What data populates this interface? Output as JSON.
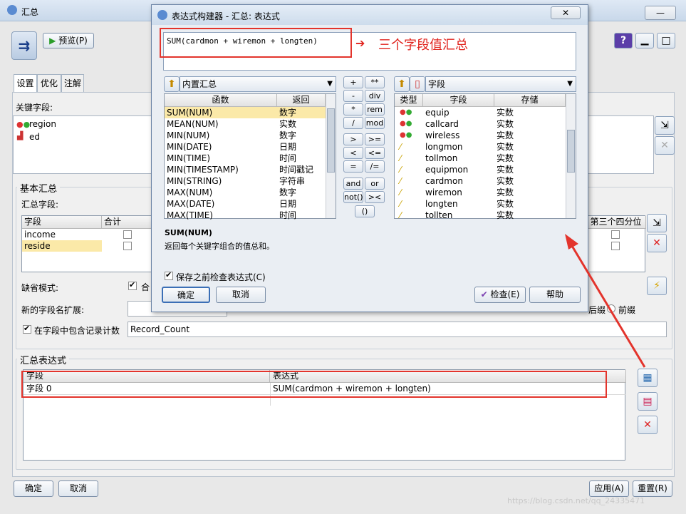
{
  "window": {
    "title": "汇总"
  },
  "toolbar": {
    "preview_label": "预览(P)"
  },
  "tabs": [
    "设置",
    "优化",
    "注解"
  ],
  "key_fields": {
    "label": "关键字段:",
    "items": [
      "region",
      "ed"
    ]
  },
  "basic": {
    "group_title": "基本汇总",
    "fields_label": "汇总字段:",
    "columns": [
      "字段",
      "合计",
      "第三个四分位"
    ],
    "rows": [
      "income",
      "reside"
    ]
  },
  "default_mode": {
    "label": "缺省模式:",
    "partial_label": "合"
  },
  "new_field_ext": {
    "label": "新的字段名扩展:",
    "suffix_option": "后缀",
    "prefix_option": "前缀"
  },
  "record_count": {
    "label": "在字段中包含记录计数",
    "value": "Record_Count"
  },
  "agg_expr": {
    "group_title": "汇总表达式",
    "columns": [
      "字段",
      "表达式"
    ],
    "rows": [
      {
        "field": "字段 0",
        "expr": "SUM(cardmon + wiremon + longten)"
      }
    ]
  },
  "footer": {
    "ok": "确定",
    "cancel": "取消",
    "apply": "应用(A)",
    "reset": "重置(R)"
  },
  "watermark": "https://blog.csdn.net/qq_24335471",
  "dialog": {
    "title": "表达式构建器 - 汇总: 表达式",
    "expression": "SUM(cardmon + wiremon + longten)",
    "annotation": "三个字段值汇总",
    "functions_combo": "内置汇总",
    "func_columns": [
      "函数",
      "返回"
    ],
    "functions": [
      {
        "name": "SUM(NUM)",
        "ret": "数字"
      },
      {
        "name": "MEAN(NUM)",
        "ret": "实数"
      },
      {
        "name": "MIN(NUM)",
        "ret": "数字"
      },
      {
        "name": "MIN(DATE)",
        "ret": "日期"
      },
      {
        "name": "MIN(TIME)",
        "ret": "时间"
      },
      {
        "name": "MIN(TIMESTAMP)",
        "ret": "时间戳记"
      },
      {
        "name": "MIN(STRING)",
        "ret": "字符串"
      },
      {
        "name": "MAX(NUM)",
        "ret": "数字"
      },
      {
        "name": "MAX(DATE)",
        "ret": "日期"
      },
      {
        "name": "MAX(TIME)",
        "ret": "时间"
      }
    ],
    "operators": [
      [
        "+",
        "**"
      ],
      [
        "-",
        "div"
      ],
      [
        "*",
        "rem"
      ],
      [
        "/",
        "mod"
      ],
      [
        ">",
        ">="
      ],
      [
        "<",
        "<="
      ],
      [
        "=",
        "/="
      ],
      [
        "and",
        "or"
      ],
      [
        "not()",
        "><"
      ],
      [
        "()"
      ]
    ],
    "fields_combo": "字段",
    "field_columns": [
      "类型",
      "字段",
      "存储"
    ],
    "fields": [
      {
        "name": "equip",
        "storage": "实数",
        "type": "nominal"
      },
      {
        "name": "callcard",
        "storage": "实数",
        "type": "nominal"
      },
      {
        "name": "wireless",
        "storage": "实数",
        "type": "nominal"
      },
      {
        "name": "longmon",
        "storage": "实数",
        "type": "continuous"
      },
      {
        "name": "tollmon",
        "storage": "实数",
        "type": "continuous"
      },
      {
        "name": "equipmon",
        "storage": "实数",
        "type": "continuous"
      },
      {
        "name": "cardmon",
        "storage": "实数",
        "type": "continuous"
      },
      {
        "name": "wiremon",
        "storage": "实数",
        "type": "continuous"
      },
      {
        "name": "longten",
        "storage": "实数",
        "type": "continuous"
      },
      {
        "name": "tollten",
        "storage": "实数",
        "type": "continuous"
      }
    ],
    "desc_title": "SUM(NUM)",
    "desc_text": "返回每个关键字组合的值总和。",
    "check_before_save": "保存之前检查表达式(C)",
    "ok": "确定",
    "cancel": "取消",
    "check": "检查(E)",
    "help": "帮助"
  },
  "colors": {
    "highlight": "#fbe9a8",
    "annotation_red": "#e0221c",
    "title_bar": "#cddcec"
  }
}
